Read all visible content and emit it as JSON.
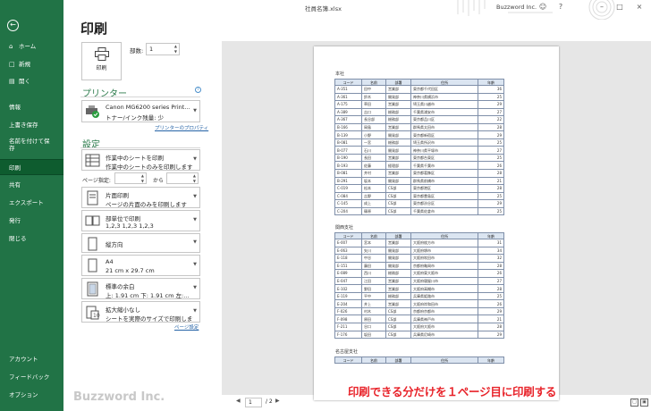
{
  "app": {
    "file_title": "社員名簿.xlsx",
    "user": "Buzzword Inc.",
    "watermark": "Buzzword Inc.",
    "caption": "印刷できる分だけを１ページ目に印刷する"
  },
  "nav": {
    "items": [
      {
        "label": "ホーム",
        "icon": "home-icon"
      },
      {
        "label": "新規",
        "icon": "new-file-icon"
      },
      {
        "label": "開く",
        "icon": "folder-icon"
      },
      {
        "label": "情報"
      },
      {
        "label": "上書き保存"
      },
      {
        "label": "名前を付けて保存"
      },
      {
        "label": "印刷"
      },
      {
        "label": "共有"
      },
      {
        "label": "エクスポート"
      },
      {
        "label": "発行"
      },
      {
        "label": "閉じる"
      },
      {
        "label": "アカウント"
      },
      {
        "label": "フィードバック"
      },
      {
        "label": "オプション"
      }
    ]
  },
  "print": {
    "heading": "印刷",
    "button_label": "印刷",
    "copies_label": "部数:",
    "copies_value": "1",
    "printer_heading": "プリンター",
    "printer_name": "Canon MG6200 series Print...",
    "printer_status": "トナー/インク残量: 少",
    "printer_props": "プリンターのプロパティ",
    "settings_heading": "設定",
    "settings": [
      {
        "l1": "作業中のシートを印刷",
        "l2": "作業中のシートのみを印刷します"
      },
      {
        "l1": "片面印刷",
        "l2": "ページの片面のみを印刷します"
      },
      {
        "l1": "部単位で印刷",
        "l2": "1,2,3    1,2,3    1,2,3"
      },
      {
        "l1": "縦方向",
        "l2": ""
      },
      {
        "l1": "A4",
        "l2": "21 cm x 29.7 cm"
      },
      {
        "l1": "標準の余白",
        "l2": "上: 1.91 cm 下: 1.91 cm 左:..."
      },
      {
        "l1": "拡大縮小なし",
        "l2": "シートを実際のサイズで印刷します"
      }
    ],
    "pages_label": "ページ指定:",
    "pages_to": "から",
    "page_setup": "ページ設定"
  },
  "pager": {
    "current": "1",
    "total": "/ 2"
  },
  "preview": {
    "headers": [
      "コード",
      "名前",
      "部署",
      "住所",
      "年齢"
    ],
    "section1_title": "本社",
    "section1_rows": [
      [
        "A-351",
        "田中",
        "営業部",
        "東京都千代田区",
        "36"
      ],
      [
        "A-361",
        "鈴木",
        "開発部",
        "神奈川県横浜市",
        "25"
      ],
      [
        "A-175",
        "草田",
        "営業部",
        "埼玉県川越市",
        "29"
      ],
      [
        "A-389",
        "吉口",
        "総務部",
        "千葉県浦安市",
        "27"
      ],
      [
        "A-367",
        "長谷部",
        "総務部",
        "東京都品川区",
        "22"
      ],
      [
        "B-166",
        "岡島",
        "営業部",
        "群馬県太田市",
        "28"
      ],
      [
        "B-139",
        "小野",
        "開発部",
        "東京都新宿区",
        "29"
      ],
      [
        "B-081",
        "一宮",
        "総務部",
        "埼玉県所沢市",
        "25"
      ],
      [
        "B-077",
        "石川",
        "開発部",
        "神奈川県平塚市",
        "27"
      ],
      [
        "B-190",
        "長田",
        "営業部",
        "東京都台東区",
        "25"
      ],
      [
        "B-193",
        "佐藤",
        "経理部",
        "千葉県千葉市",
        "26"
      ],
      [
        "B-081",
        "井村",
        "営業部",
        "東京都葛飾区",
        "28"
      ],
      [
        "B-291",
        "坂本",
        "開発部",
        "群馬県前橋市",
        "21"
      ],
      [
        "C-019",
        "松本",
        "CS部",
        "東京都港区",
        "28"
      ],
      [
        "C-084",
        "吉野",
        "CS部",
        "東京都豊島区",
        "25"
      ],
      [
        "C-145",
        "成上",
        "CS部",
        "東京都渋谷区",
        "29"
      ],
      [
        "C-204",
        "篠原",
        "CS部",
        "千葉県佐倉市",
        "25"
      ]
    ],
    "section2_title": "関西支社",
    "section2_rows": [
      [
        "E-007",
        "宮本",
        "営業部",
        "大阪府枚方市",
        "31"
      ],
      [
        "E-063",
        "矢川",
        "開発部",
        "大阪府堺市",
        "34"
      ],
      [
        "E-118",
        "中谷",
        "開発部",
        "大阪府吹田市",
        "32"
      ],
      [
        "E-151",
        "藤田",
        "開発部",
        "京都府亀岡市",
        "28"
      ],
      [
        "E-089",
        "西川",
        "総務部",
        "大阪府東大阪市",
        "26"
      ],
      [
        "E-047",
        "江田",
        "営業部",
        "大阪府寝屋川市",
        "27"
      ],
      [
        "E-102",
        "野田",
        "営業部",
        "大阪府高槻市",
        "28"
      ],
      [
        "E-119",
        "平中",
        "総務部",
        "兵庫県姫路市",
        "25"
      ],
      [
        "E-204",
        "井上",
        "営業部",
        "大阪府岸和田市",
        "26"
      ],
      [
        "F-026",
        "村木",
        "CS部",
        "京都府京都市",
        "29"
      ],
      [
        "F-098",
        "原田",
        "CS部",
        "兵庫県神戸市",
        "21"
      ],
      [
        "F-211",
        "谷口",
        "CS部",
        "大阪府大阪市",
        "28"
      ],
      [
        "F-176",
        "坂田",
        "CS部",
        "兵庫県尼崎市",
        "29"
      ]
    ],
    "section3_title": "名古屋支社"
  }
}
